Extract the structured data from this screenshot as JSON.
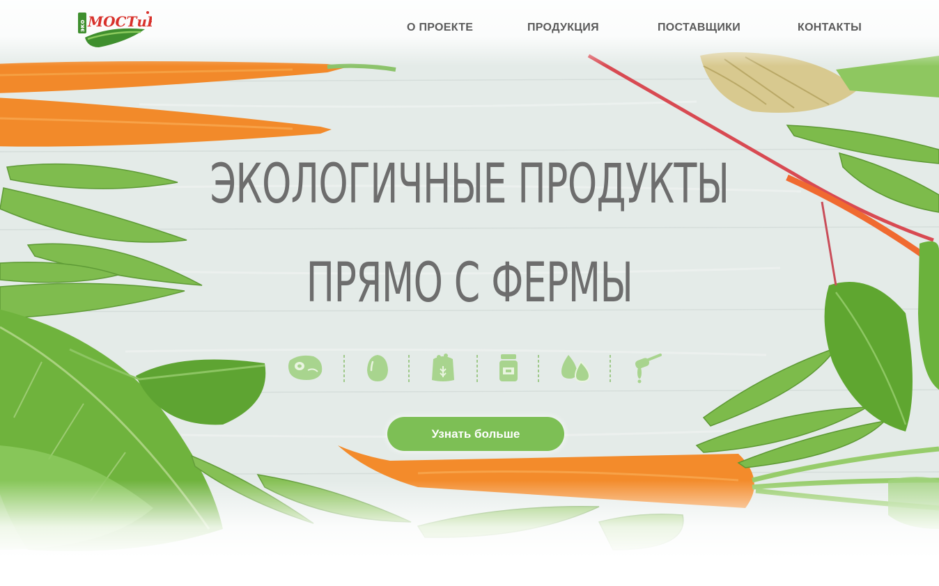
{
  "logo": {
    "prefix": "эко",
    "name": "МОСТиК"
  },
  "nav": {
    "items": [
      {
        "label": "О ПРОЕКТЕ"
      },
      {
        "label": "ПРОДУКЦИЯ"
      },
      {
        "label": "ПОСТАВЩИКИ"
      },
      {
        "label": "КОНТАКТЫ"
      }
    ]
  },
  "hero": {
    "title_line1": "ЭКОЛОГИЧНЫЕ ПРОДУКТЫ",
    "title_line2": "ПРЯМО С ФЕРМЫ",
    "categories": [
      {
        "icon": "meat-icon"
      },
      {
        "icon": "egg-icon"
      },
      {
        "icon": "flour-bag-icon"
      },
      {
        "icon": "jar-icon"
      },
      {
        "icon": "milk-drops-icon"
      },
      {
        "icon": "honey-dipper-icon"
      }
    ],
    "cta_label": "Узнать больше"
  },
  "colors": {
    "accent_green": "#7dbf55",
    "icon_green": "#a8d48e",
    "title_gray": "#6d6d6d",
    "nav_gray": "#5a5a5a",
    "logo_red": "#d8312b",
    "logo_green": "#3f8f2e"
  }
}
